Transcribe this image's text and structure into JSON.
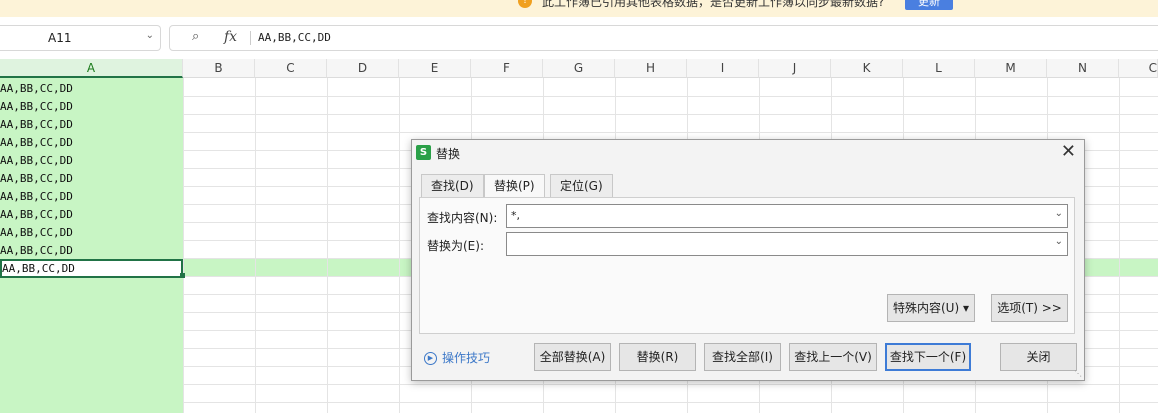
{
  "notice": {
    "message": "此工作簿已引用其他表格数据，是否更新工作簿以同步最新数据?",
    "update_label": "更新"
  },
  "formula_bar": {
    "name_box": "A11",
    "fx_label": "fx",
    "content": "AA,BB,CC,DD"
  },
  "columns": [
    "A",
    "B",
    "C",
    "D",
    "E",
    "F",
    "G",
    "H",
    "I",
    "J",
    "K",
    "L",
    "M",
    "N",
    "C"
  ],
  "cells": [
    "AA,BB,CC,DD",
    "AA,BB,CC,DD",
    "AA,BB,CC,DD",
    "AA,BB,CC,DD",
    "AA,BB,CC,DD",
    "AA,BB,CC,DD",
    "AA,BB,CC,DD",
    "AA,BB,CC,DD",
    "AA,BB,CC,DD",
    "AA,BB,CC,DD",
    "AA,BB,CC,DD"
  ],
  "dialog": {
    "logo": "S",
    "title": "替换",
    "tabs": [
      "查找(D)",
      "替换(P)",
      "定位(G)"
    ],
    "find_label": "查找内容(N):",
    "find_value": "*,",
    "replace_label": "替换为(E):",
    "replace_value": "",
    "special_label": "特殊内容(U) ▾",
    "options_label": "选项(T) >>",
    "tips_label": "操作技巧",
    "buttons": {
      "replace_all": "全部替换(A)",
      "replace": "替换(R)",
      "find_all": "查找全部(I)",
      "find_prev": "查找上一个(V)",
      "find_next": "查找下一个(F)",
      "close": "关闭"
    }
  }
}
